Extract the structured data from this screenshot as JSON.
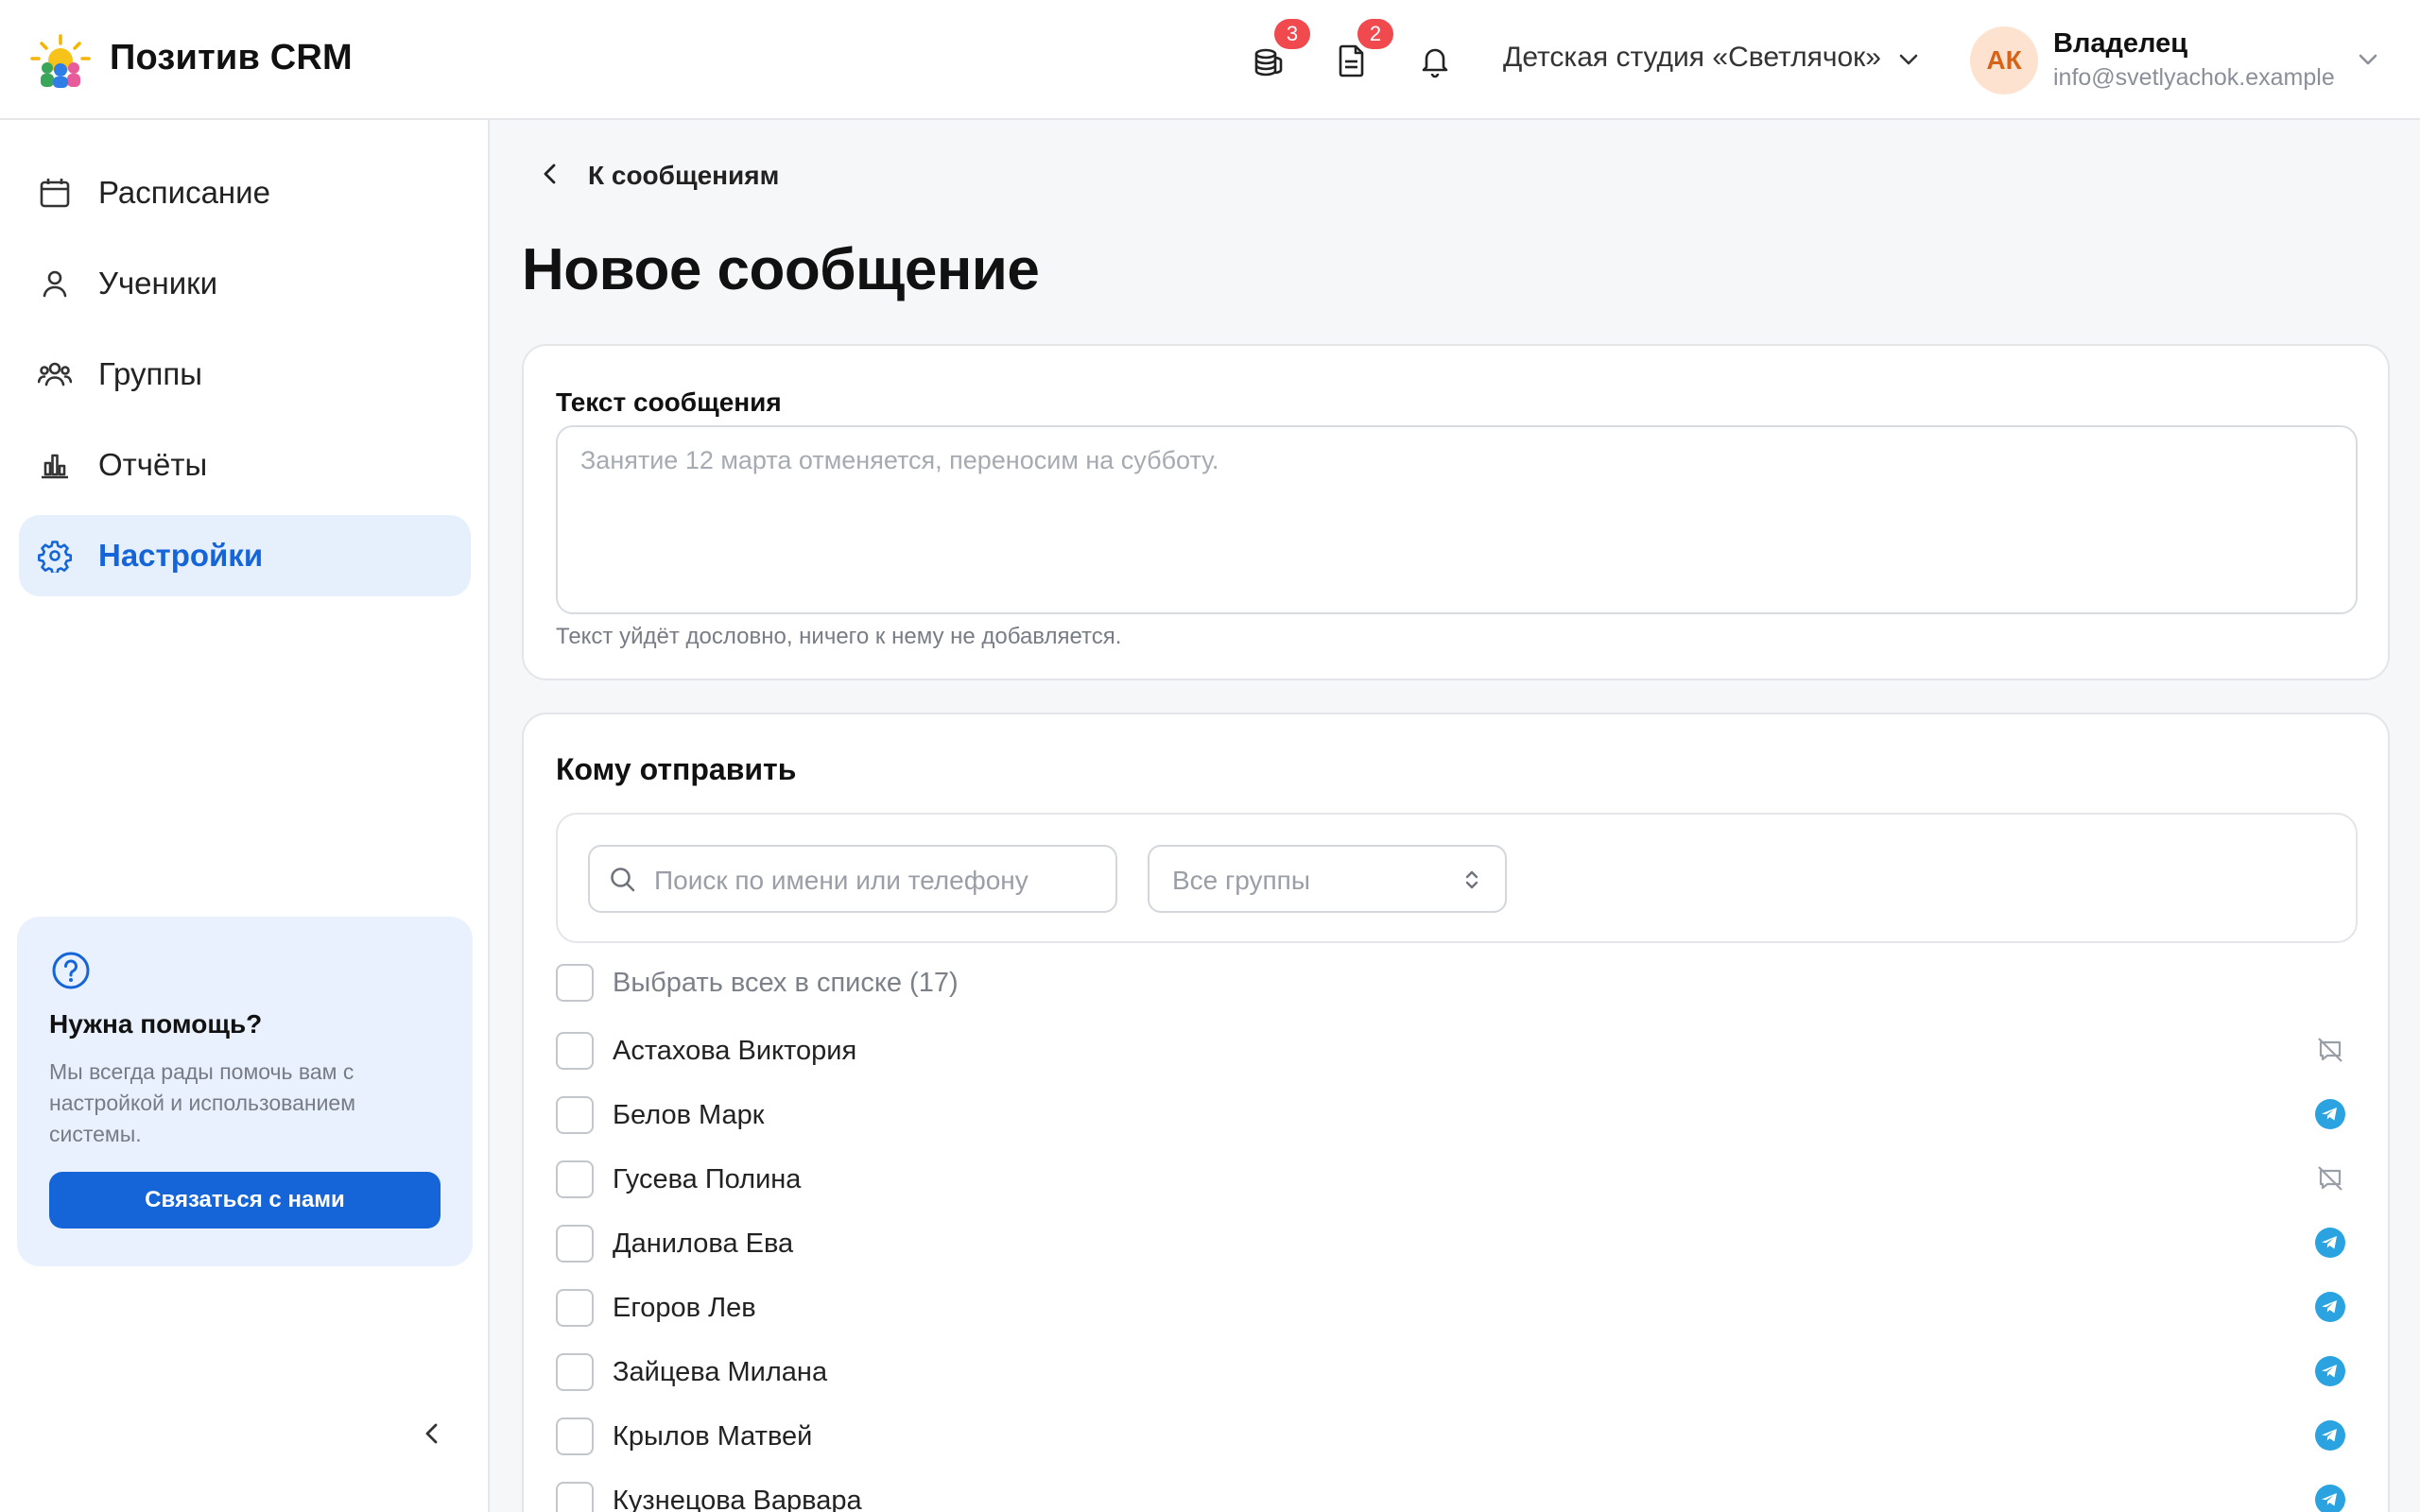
{
  "header": {
    "brand": "Позитив CRM",
    "badges": {
      "payments": "3",
      "documents": "2"
    },
    "studio": "Детская студия «Светлячок»",
    "user": {
      "initials": "АК",
      "role": "Владелец",
      "email": "info@svetlyachok.example"
    }
  },
  "sidebar": {
    "items": [
      {
        "label": "Расписание",
        "icon": "calendar-icon"
      },
      {
        "label": "Ученики",
        "icon": "user-icon"
      },
      {
        "label": "Группы",
        "icon": "users-icon"
      },
      {
        "label": "Отчёты",
        "icon": "bar-chart-icon"
      },
      {
        "label": "Настройки",
        "icon": "gear-icon",
        "active": true
      }
    ],
    "help": {
      "title": "Нужна помощь?",
      "text": "Мы всегда рады помочь вам с настройкой и использованием системы.",
      "button": "Связаться с нами"
    }
  },
  "main": {
    "back_label": "К сообщениям",
    "title": "Новое сообщение",
    "message": {
      "label": "Текст сообщения",
      "placeholder": "Занятие 12 марта отменяется, переносим на субботу.",
      "hint": "Текст уйдёт дословно, ничего к нему не добавляется."
    },
    "recipients": {
      "title": "Кому отправить",
      "search_placeholder": "Поиск по имени или телефону",
      "group_select": "Все группы",
      "select_all": "Выбрать всех в списке (17)",
      "list": [
        {
          "name": "Астахова Виктория",
          "channel": "none"
        },
        {
          "name": "Белов Марк",
          "channel": "telegram"
        },
        {
          "name": "Гусева Полина",
          "channel": "none"
        },
        {
          "name": "Данилова Ева",
          "channel": "telegram"
        },
        {
          "name": "Егоров Лев",
          "channel": "telegram"
        },
        {
          "name": "Зайцева Милана",
          "channel": "telegram"
        },
        {
          "name": "Крылов Матвей",
          "channel": "telegram"
        },
        {
          "name": "Кузнецова Варвара",
          "channel": "telegram"
        }
      ]
    }
  },
  "colors": {
    "accent": "#1565d8",
    "badge": "#f04a4f",
    "telegram": "#2aa3e0"
  }
}
